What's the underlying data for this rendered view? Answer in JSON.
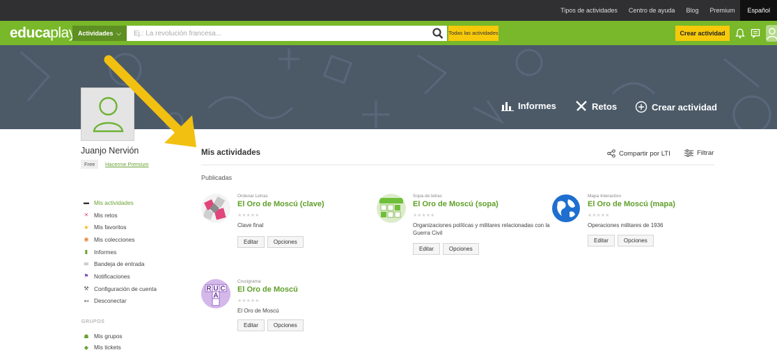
{
  "topbar": {
    "links": [
      "Tipos de actividades",
      "Centro de ayuda",
      "Blog",
      "Premium"
    ],
    "language": "Español"
  },
  "header": {
    "logo_bold": "educa",
    "logo_light": "play",
    "category_dropdown": "Actividades",
    "search_placeholder": "Ej.: La revolución francesa...",
    "all_activities_button": "Todas las actividades",
    "create_button": "Crear actividad"
  },
  "banner": {
    "reports_label": "Informes",
    "challenges_label": "Retos",
    "create_label": "Crear actividad"
  },
  "profile": {
    "name": "Juanjo Nervión",
    "plan_badge": "Free",
    "premium_link": "Hacerme Premium"
  },
  "sidebar": {
    "items": [
      {
        "label": "Mis actividades",
        "icon": "folder-icon",
        "active": true
      },
      {
        "label": "Mis retos",
        "icon": "swords-icon",
        "active": false
      },
      {
        "label": "Mis favoritos",
        "icon": "star-icon",
        "active": false
      },
      {
        "label": "Mis colecciones",
        "icon": "collections-icon",
        "active": false
      },
      {
        "label": "Informes",
        "icon": "bar-chart-icon",
        "active": false
      },
      {
        "label": "Bandeja de entrada",
        "icon": "inbox-icon",
        "active": false
      },
      {
        "label": "Notificaciones",
        "icon": "flag-icon",
        "active": false
      },
      {
        "label": "Configuración de cuenta",
        "icon": "wrench-icon",
        "active": false
      },
      {
        "label": "Desconectar",
        "icon": "logout-icon",
        "active": false
      }
    ],
    "groups_title": "GRUPOS",
    "group_items": [
      {
        "label": "Mis grupos",
        "icon": "group-icon"
      },
      {
        "label": "Mis tickets",
        "icon": "ticket-icon"
      }
    ]
  },
  "content": {
    "section_title": "Mis actividades",
    "share_label": "Compartir por LTI",
    "filter_label": "Filtrar",
    "published_label": "Publicadas",
    "edit_label": "Editar",
    "options_label": "Opciones",
    "stars": "★★★★★",
    "activities": [
      {
        "type": "Ordenar Letras",
        "title": "El Oro de Moscú (clave)",
        "description": "Clave final",
        "thumb": "letters-thumb"
      },
      {
        "type": "Sopa de letras",
        "title": "El Oro de Moscú (sopa)",
        "description": "Organizaciones políticas y militares relacionadas con la Guerra Civil",
        "thumb": "wordsearch-thumb"
      },
      {
        "type": "Mapa Interactivo",
        "title": "El Oro de Moscú (mapa)",
        "description": "Operaciones militares de 1936",
        "thumb": "globe-thumb"
      },
      {
        "type": "Crucigrama",
        "title": "El Oro de Moscú",
        "description": "El Oro de Moscú",
        "thumb": "crossword-thumb",
        "thumb_letters": [
          "R",
          "U",
          "C",
          "A"
        ]
      }
    ]
  },
  "colors": {
    "brand_green": "#78b82a",
    "accent_yellow": "#f7c90b",
    "banner_gray": "#4c5a68",
    "link_green": "#5e9e28",
    "arrow": "#f2c011"
  }
}
